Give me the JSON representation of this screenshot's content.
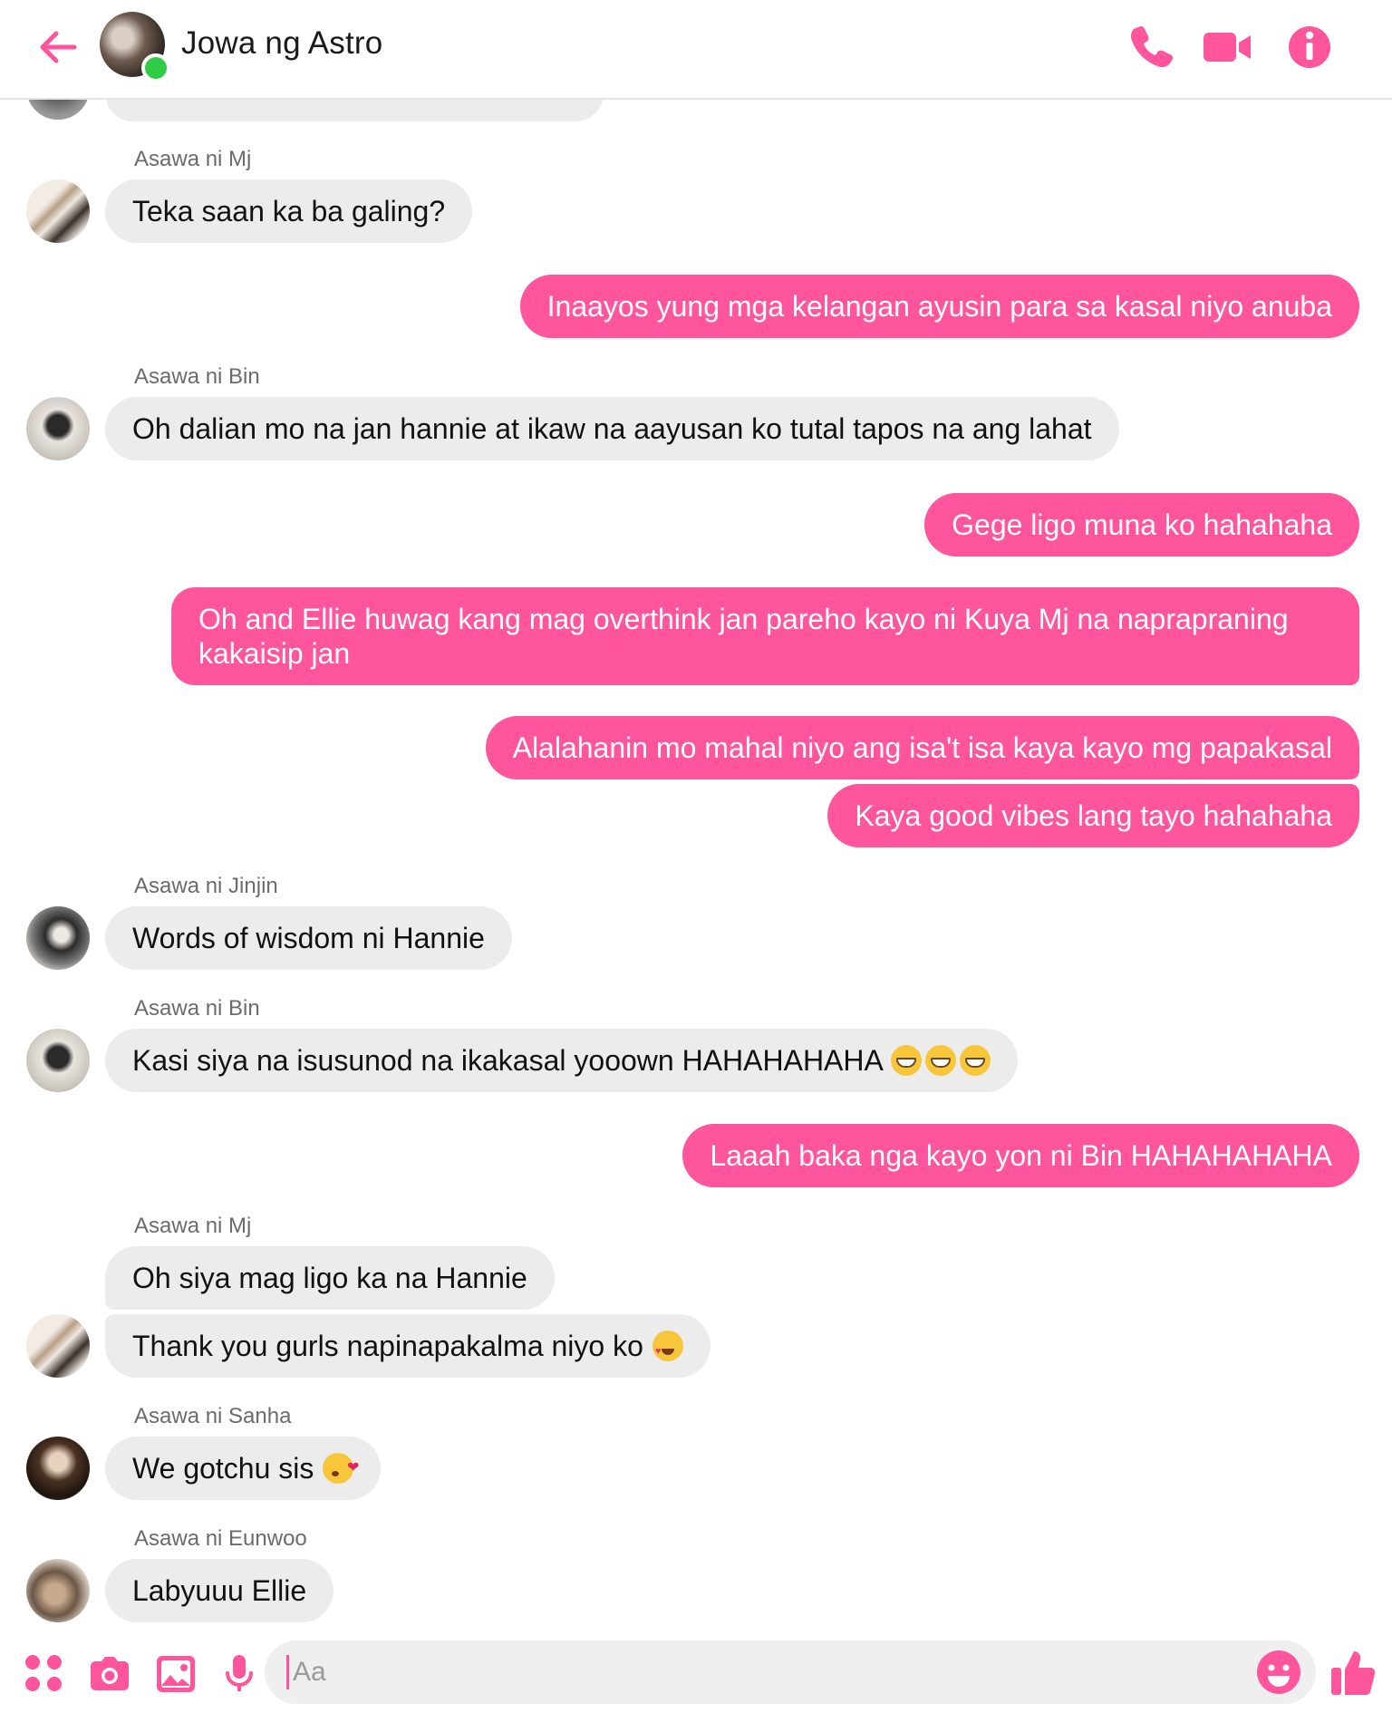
{
  "header": {
    "title": "Jowa ng Astro",
    "back_icon": "arrow-left-icon",
    "actions": [
      "phone-icon",
      "video-camera-icon",
      "info-icon"
    ],
    "online": true
  },
  "colors": {
    "accent": "#ff559c",
    "incoming_bubble": "#ececec",
    "online": "#31cc46"
  },
  "messages": {
    "m1": {
      "sender": "Asawa ni Mj",
      "text": "Teka saan ka ba galing?"
    },
    "m2": {
      "text": "Inaayos yung mga kelangan ayusin para sa kasal niyo anuba"
    },
    "m3": {
      "sender": "Asawa ni Bin",
      "text": "Oh dalian mo na jan hannie at ikaw na aayusan ko tutal tapos na ang lahat"
    },
    "m4": {
      "text": "Gege ligo muna ko hahahaha"
    },
    "m5": {
      "text": "Oh and Ellie huwag kang mag overthink jan pareho kayo ni Kuya Mj na naprapraning kakaisip jan"
    },
    "m6": {
      "text": "Alalahanin mo mahal niyo ang isa't isa kaya kayo mg papakasal"
    },
    "m7": {
      "text": "Kaya good vibes lang tayo hahahaha"
    },
    "m8": {
      "sender": "Asawa ni Jinjin",
      "text": "Words of wisdom ni Hannie"
    },
    "m9": {
      "sender": "Asawa ni Bin",
      "text": "Kasi siya na isusunod na ikakasal yooown HAHAHAHAHA",
      "emoji": "grinning-face-icon ×3"
    },
    "m10": {
      "text": "Laaah baka nga kayo yon ni Bin HAHAHAHAHA"
    },
    "m11": {
      "sender": "Asawa ni Mj",
      "text": "Oh siya mag ligo ka na Hannie"
    },
    "m12": {
      "text": "Thank you gurls napinapakalma niyo ko",
      "emoji": "heart-eyes-icon"
    },
    "m13": {
      "sender": "Asawa ni Sanha",
      "text": "We gotchu sis",
      "emoji": "kissing-heart-icon"
    },
    "m14": {
      "sender": "Asawa ni Eunwoo",
      "text": "Labyuuu Ellie"
    }
  },
  "composer": {
    "placeholder": "Aa",
    "icons": [
      "apps-icon",
      "camera-icon",
      "gallery-icon",
      "microphone-icon",
      "emoji-icon",
      "thumbs-up-icon"
    ]
  }
}
